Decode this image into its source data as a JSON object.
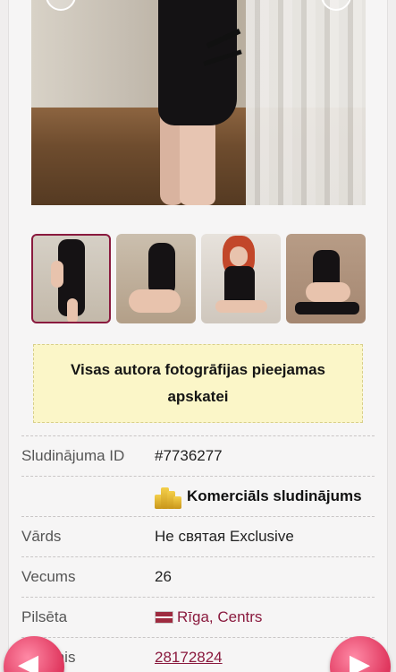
{
  "gallery": {
    "main_photo_alt": "",
    "thumbnails": [
      {
        "active": true
      },
      {
        "active": false
      },
      {
        "active": false
      },
      {
        "active": false
      }
    ]
  },
  "notice": {
    "text": "Visas autora fotogrāfijas pieejamas apskatei"
  },
  "details": {
    "ad_id": {
      "label": "Sludinājuma ID",
      "value": "#7736277"
    },
    "commercial": {
      "value": "Komerciāls sludinājums",
      "icon": "coins-icon"
    },
    "name": {
      "label": "Vārds",
      "value": "Не святая Exclusive"
    },
    "age": {
      "label": "Vecums",
      "value": "26"
    },
    "city": {
      "label": "Pilsēta",
      "value": "Rīga, Centrs",
      "icon": "latvia-flag-icon"
    },
    "phone": {
      "label": "Tālrunis",
      "value": "28172824"
    }
  },
  "navigation": {
    "prev_icon": "arrow-left-icon",
    "next_icon": "arrow-right-icon"
  },
  "colors": {
    "accent": "#8a1a3e",
    "notice_bg": "#fbf6c8",
    "arrow": "#e0385f"
  }
}
